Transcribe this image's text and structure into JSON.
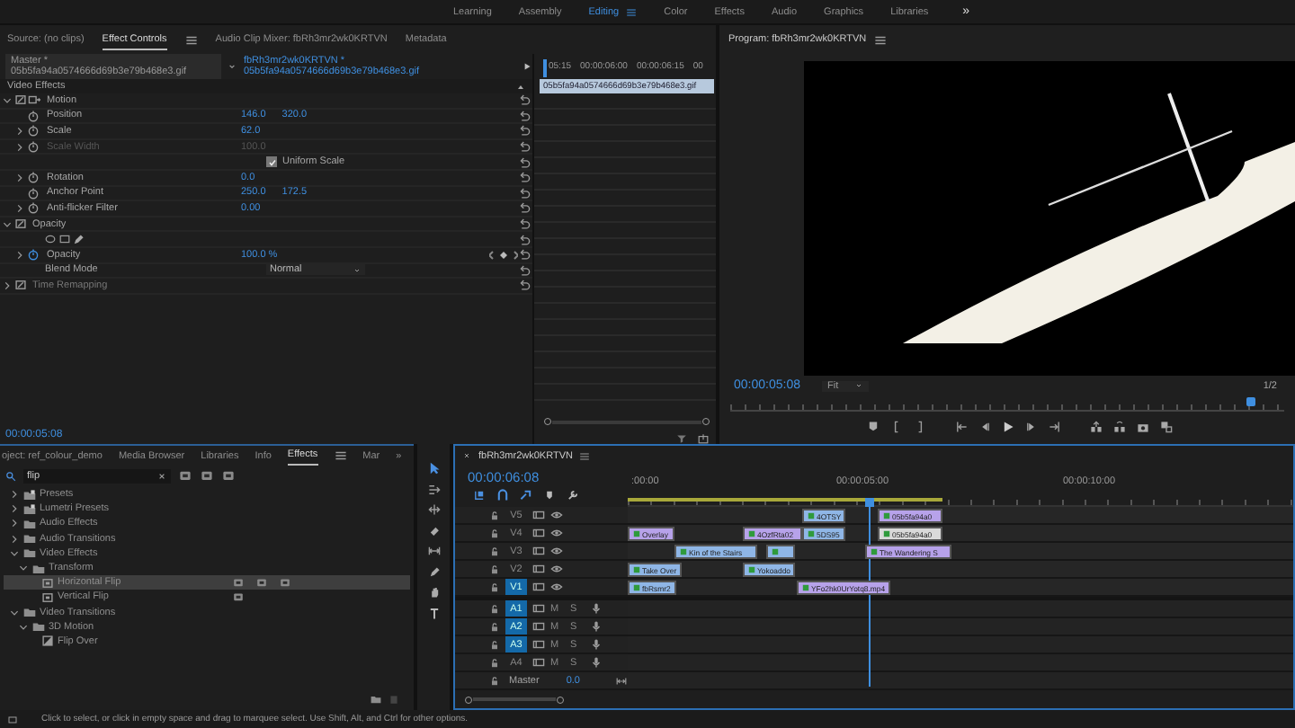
{
  "workspaces": {
    "tabs": [
      {
        "label": "Learning",
        "selected": false
      },
      {
        "label": "Assembly",
        "selected": false
      },
      {
        "label": "Editing",
        "selected": true
      },
      {
        "label": "Color",
        "selected": false
      },
      {
        "label": "Effects",
        "selected": false
      },
      {
        "label": "Audio",
        "selected": false
      },
      {
        "label": "Graphics",
        "selected": false
      },
      {
        "label": "Libraries",
        "selected": false
      }
    ],
    "overflow": "»"
  },
  "effect_controls": {
    "tabs": [
      {
        "label": "Source: (no clips)",
        "selected": false
      },
      {
        "label": "Effect Controls",
        "selected": true
      },
      {
        "label": "Audio Clip Mixer: fbRh3mr2wk0KRTVN",
        "selected": false
      },
      {
        "label": "Metadata",
        "selected": false
      }
    ],
    "master_clip": "Master * 05b5fa94a0574666d69b3e79b468e3.gif",
    "sequence_clip": "fbRh3mr2wk0KRTVN * 05b5fa94a0574666d69b3e79b468e3.gif",
    "section": "Video Effects",
    "effects": [
      {
        "name": "Motion",
        "expanded": true,
        "properties": [
          {
            "kind": "value",
            "name": "Position",
            "values": [
              "146.0",
              "320.0"
            ],
            "expandable": false,
            "disabled": false,
            "animated": false
          },
          {
            "kind": "value",
            "name": "Scale",
            "values": [
              "62.0"
            ],
            "expandable": true,
            "disabled": false,
            "animated": false
          },
          {
            "kind": "value",
            "name": "Scale Width",
            "values": [
              "100.0"
            ],
            "expandable": true,
            "disabled": true,
            "animated": false
          },
          {
            "kind": "checkbox",
            "label": "Uniform Scale",
            "checked": true
          },
          {
            "kind": "value",
            "name": "Rotation",
            "values": [
              "0.0"
            ],
            "expandable": true,
            "disabled": false,
            "animated": false
          },
          {
            "kind": "value",
            "name": "Anchor Point",
            "values": [
              "250.0",
              "172.5"
            ],
            "expandable": false,
            "disabled": false,
            "animated": false
          },
          {
            "kind": "value",
            "name": "Anti-flicker Filter",
            "values": [
              "0.00"
            ],
            "expandable": true,
            "disabled": false,
            "animated": false
          }
        ]
      },
      {
        "name": "Opacity",
        "expanded": true,
        "properties": [
          {
            "kind": "masks"
          },
          {
            "kind": "value",
            "name": "Opacity",
            "values": [
              "100.0 %"
            ],
            "expandable": true,
            "disabled": false,
            "animated": true
          },
          {
            "kind": "dropdown",
            "name": "Blend Mode",
            "value": "Normal"
          }
        ]
      },
      {
        "name": "Time Remapping",
        "expanded": false
      }
    ],
    "timecode": "00:00:05:08",
    "mini_timeline": {
      "ticks": [
        "05:15",
        "00:00:06:00",
        "00:00:06:15",
        "00"
      ],
      "clip": "05b5fa94a0574666d69b3e79b468e3.gif"
    }
  },
  "program": {
    "title": "Program: fbRh3mr2wk0KRTVN",
    "timecode": "00:00:05:08",
    "zoom": "Fit",
    "resolution": "1/2"
  },
  "effects_panel": {
    "tabs": [
      {
        "label": "oject: ref_colour_demo",
        "selected": false
      },
      {
        "label": "Media Browser",
        "selected": false
      },
      {
        "label": "Libraries",
        "selected": false
      },
      {
        "label": "Info",
        "selected": false
      },
      {
        "label": "Effects",
        "selected": true
      },
      {
        "label": "Mar",
        "selected": false
      }
    ],
    "overflow": "»",
    "search": {
      "value": "flip"
    },
    "tree": [
      {
        "label": "Presets",
        "kind": "preset",
        "expanded": false,
        "selected": false
      },
      {
        "label": "Lumetri Presets",
        "kind": "preset",
        "expanded": false,
        "selected": false
      },
      {
        "label": "Audio Effects",
        "kind": "folder",
        "expanded": false,
        "selected": false
      },
      {
        "label": "Audio Transitions",
        "kind": "folder",
        "expanded": false,
        "selected": false
      },
      {
        "label": "Video Effects",
        "kind": "folder",
        "expanded": true,
        "selected": false,
        "children": [
          {
            "label": "Transform",
            "kind": "folder",
            "expanded": true,
            "selected": false,
            "children": [
              {
                "label": "Horizontal Flip",
                "kind": "effect",
                "selected": true,
                "accelerated": true,
                "bit32": true,
                "yuv": true
              },
              {
                "label": "Vertical Flip",
                "kind": "effect",
                "selected": false,
                "accelerated": true,
                "bit32": false,
                "yuv": false
              }
            ]
          }
        ]
      },
      {
        "label": "Video Transitions",
        "kind": "folder",
        "expanded": true,
        "selected": false,
        "children": [
          {
            "label": "3D Motion",
            "kind": "folder",
            "expanded": true,
            "selected": false,
            "children": [
              {
                "label": "Flip Over",
                "kind": "transition",
                "selected": false
              }
            ]
          }
        ]
      }
    ]
  },
  "timeline": {
    "title": "fbRh3mr2wk0KRTVN",
    "timecode": "00:00:06:08",
    "ruler": [
      ":00:00",
      "00:00:05:00",
      "00:00:10:00"
    ],
    "video_tracks": [
      {
        "name": "V5",
        "targeted": false,
        "clips": [
          {
            "label": "4OTSY",
            "color": "#8fb6e6"
          },
          {
            "label": "05b5fa94a0",
            "color": "#b7a2ea"
          }
        ]
      },
      {
        "name": "V4",
        "targeted": false,
        "clips": [
          {
            "label": "Overlay",
            "color": "#b7a2ea"
          },
          {
            "label": "4OzfRta02",
            "color": "#b7a2ea"
          },
          {
            "label": "5DS95",
            "color": "#8fb6e6"
          },
          {
            "label": "05b5fa94a0",
            "color": "#d9d9d9"
          }
        ]
      },
      {
        "name": "V3",
        "targeted": false,
        "clips": [
          {
            "label": "Kin of the Stairs",
            "color": "#8fb6e6"
          },
          {
            "color": "#8fb6e6"
          },
          {
            "label": "The Wandering S",
            "color": "#b7a2ea"
          }
        ]
      },
      {
        "name": "V2",
        "targeted": false,
        "clips": [
          {
            "label": "Take Over",
            "color": "#8fb6e6"
          },
          {
            "label": "Yokoaddo",
            "color": "#8fb6e6"
          }
        ]
      },
      {
        "name": "V1",
        "targeted": true,
        "clips": [
          {
            "label": "fbRsmr2",
            "color": "#8fb6e6"
          },
          {
            "label": "YFo2hk0UrYotq8.mp4",
            "color": "#b7a2ea"
          }
        ]
      }
    ],
    "audio_tracks": [
      {
        "name": "A1",
        "targeted": true,
        "mute": "M",
        "solo": "S"
      },
      {
        "name": "A2",
        "targeted": true,
        "mute": "M",
        "solo": "S"
      },
      {
        "name": "A3",
        "targeted": true,
        "mute": "M",
        "solo": "S"
      },
      {
        "name": "A4",
        "targeted": false,
        "mute": "M",
        "solo": "S"
      }
    ],
    "master": {
      "label": "Master",
      "value": "0.0"
    }
  },
  "status_bar": "Click to select, or click in empty space and drag to marquee select. Use Shift, Alt, and Ctrl for other options."
}
